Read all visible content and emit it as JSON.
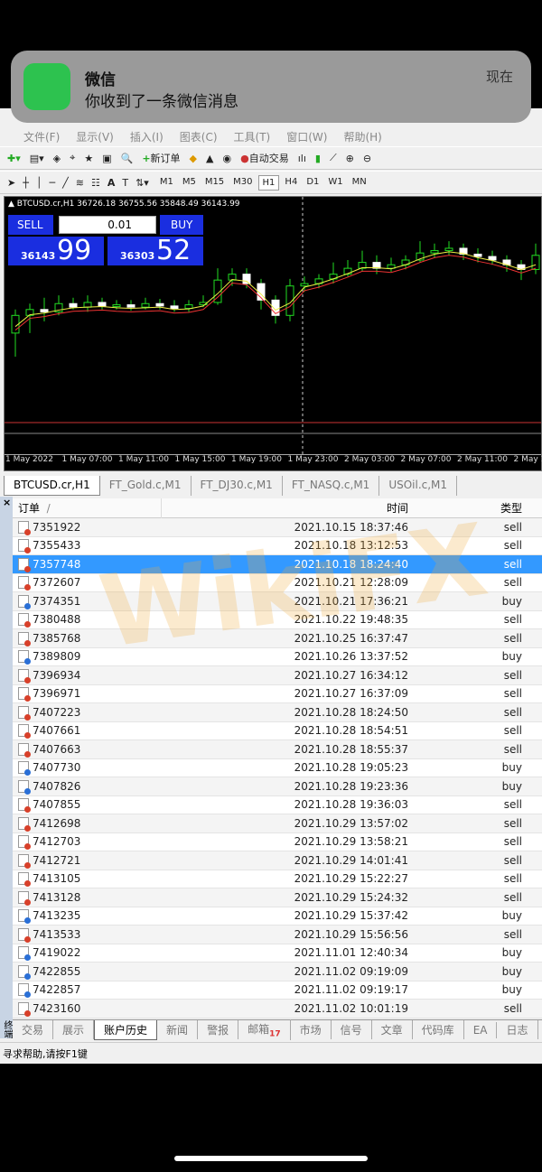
{
  "notification": {
    "app": "微信",
    "message": "你收到了一条微信消息",
    "time": "现在"
  },
  "menu": [
    "文件(F)",
    "显示(V)",
    "插入(I)",
    "图表(C)",
    "工具(T)",
    "窗口(W)",
    "帮助(H)"
  ],
  "toolbar": {
    "new_order": "新订单",
    "auto_trade": "自动交易"
  },
  "timeframes": [
    "M1",
    "M5",
    "M15",
    "M30",
    "H1",
    "H4",
    "D1",
    "W1",
    "MN"
  ],
  "selected_timeframe": "H1",
  "chart": {
    "symbol_info": "BTCUSD.cr,H1  36726.18 36755.56 35848.49 36143.99",
    "sell_label": "SELL",
    "buy_label": "BUY",
    "lot": "0.01",
    "sell_prefix": "36143",
    "sell_big": "99",
    "buy_prefix": "36303",
    "buy_big": "52",
    "xlabels": [
      "1 May 2022",
      "1 May 07:00",
      "1 May 11:00",
      "1 May 15:00",
      "1 May 19:00",
      "1 May 23:00",
      "2 May 03:00",
      "2 May 07:00",
      "2 May 11:00",
      "2 May 1"
    ],
    "candles": [
      [
        36100,
        36250,
        36300,
        35900
      ],
      [
        36250,
        36300,
        36350,
        36100
      ],
      [
        36300,
        36280,
        36400,
        36200
      ],
      [
        36280,
        36350,
        36420,
        36250
      ],
      [
        36350,
        36320,
        36400,
        36300
      ],
      [
        36320,
        36360,
        36420,
        36280
      ],
      [
        36360,
        36330,
        36400,
        36300
      ],
      [
        36330,
        36340,
        36380,
        36300
      ],
      [
        36340,
        36320,
        36380,
        36290
      ],
      [
        36320,
        36350,
        36400,
        36300
      ],
      [
        36350,
        36330,
        36390,
        36300
      ],
      [
        36330,
        36310,
        36380,
        36280
      ],
      [
        36310,
        36340,
        36380,
        36280
      ],
      [
        36340,
        36360,
        36420,
        36320
      ],
      [
        36360,
        36550,
        36650,
        36340
      ],
      [
        36550,
        36600,
        36650,
        36500
      ],
      [
        36600,
        36520,
        36650,
        36480
      ],
      [
        36520,
        36380,
        36560,
        36300
      ],
      [
        36380,
        36250,
        36420,
        36180
      ],
      [
        36250,
        36500,
        36560,
        36200
      ],
      [
        36500,
        36520,
        36580,
        36450
      ],
      [
        36520,
        36560,
        36600,
        36480
      ],
      [
        36560,
        36600,
        36700,
        36520
      ],
      [
        36600,
        36650,
        36720,
        36580
      ],
      [
        36650,
        36700,
        36800,
        36620
      ],
      [
        36700,
        36650,
        36760,
        36600
      ],
      [
        36650,
        36680,
        36740,
        36620
      ],
      [
        36680,
        36720,
        36760,
        36640
      ],
      [
        36720,
        36780,
        36880,
        36700
      ],
      [
        36780,
        36800,
        36860,
        36740
      ],
      [
        36800,
        36820,
        36880,
        36760
      ],
      [
        36820,
        36770,
        36860,
        36720
      ],
      [
        36770,
        36750,
        36820,
        36700
      ],
      [
        36750,
        36720,
        36800,
        36680
      ],
      [
        36720,
        36680,
        36760,
        36620
      ],
      [
        36680,
        36640,
        36720,
        36550
      ],
      [
        36640,
        36760,
        36860,
        36600
      ]
    ]
  },
  "chart_tabs": [
    "BTCUSD.cr,H1",
    "FT_Gold.c,M1",
    "FT_DJ30.c,M1",
    "FT_NASQ.c,M1",
    "USOil.c,M1"
  ],
  "table": {
    "headers": [
      "订单",
      "时间",
      "类型"
    ],
    "sort_marker": "/",
    "rows": [
      [
        "7351922",
        "2021.10.15 18:37:46",
        "sell"
      ],
      [
        "7355433",
        "2021.10.18 13:12:53",
        "sell"
      ],
      [
        "7357748",
        "2021.10.18 18:24:40",
        "sell"
      ],
      [
        "7372607",
        "2021.10.21 12:28:09",
        "sell"
      ],
      [
        "7374351",
        "2021.10.21 17:36:21",
        "buy"
      ],
      [
        "7380488",
        "2021.10.22 19:48:35",
        "sell"
      ],
      [
        "7385768",
        "2021.10.25 16:37:47",
        "sell"
      ],
      [
        "7389809",
        "2021.10.26 13:37:52",
        "buy"
      ],
      [
        "7396934",
        "2021.10.27 16:34:12",
        "sell"
      ],
      [
        "7396971",
        "2021.10.27 16:37:09",
        "sell"
      ],
      [
        "7407223",
        "2021.10.28 18:24:50",
        "sell"
      ],
      [
        "7407661",
        "2021.10.28 18:54:51",
        "sell"
      ],
      [
        "7407663",
        "2021.10.28 18:55:37",
        "sell"
      ],
      [
        "7407730",
        "2021.10.28 19:05:23",
        "buy"
      ],
      [
        "7407826",
        "2021.10.28 19:23:36",
        "buy"
      ],
      [
        "7407855",
        "2021.10.28 19:36:03",
        "sell"
      ],
      [
        "7412698",
        "2021.10.29 13:57:02",
        "sell"
      ],
      [
        "7412703",
        "2021.10.29 13:58:21",
        "sell"
      ],
      [
        "7412721",
        "2021.10.29 14:01:41",
        "sell"
      ],
      [
        "7413105",
        "2021.10.29 15:22:27",
        "sell"
      ],
      [
        "7413128",
        "2021.10.29 15:24:32",
        "sell"
      ],
      [
        "7413235",
        "2021.10.29 15:37:42",
        "buy"
      ],
      [
        "7413533",
        "2021.10.29 15:56:56",
        "sell"
      ],
      [
        "7419022",
        "2021.11.01 12:40:34",
        "buy"
      ],
      [
        "7422855",
        "2021.11.02 09:19:09",
        "buy"
      ],
      [
        "7422857",
        "2021.11.02 09:19:17",
        "buy"
      ],
      [
        "7423160",
        "2021.11.02 10:01:19",
        "sell"
      ]
    ],
    "selected_index": 2
  },
  "bottom_tabs": [
    "交易",
    "展示",
    "账户历史",
    "新闻",
    "警报",
    "邮箱",
    "市场",
    "信号",
    "文章",
    "代码库",
    "EA",
    "日志"
  ],
  "mail_count": "17",
  "side_label": "终端",
  "status": "寻求帮助,请按F1键",
  "watermark": "WikiFX"
}
